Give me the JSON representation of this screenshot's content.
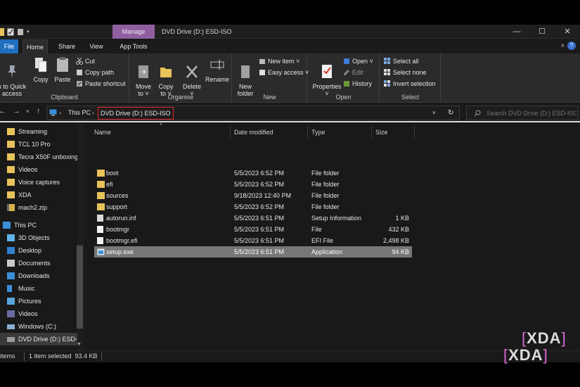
{
  "window": {
    "title": "DVD Drive (D:) ESD-ISO",
    "manage_tab": "Manage",
    "minimize": "—",
    "maximize": "☐",
    "close": "✕"
  },
  "tabs": [
    "File",
    "Home",
    "Share",
    "View",
    "App Tools"
  ],
  "active_tab": "Home",
  "ribbon_collapse": "˄",
  "help": "?",
  "ribbon": {
    "clipboard": {
      "label": "Clipboard",
      "pin": "n to Quick\naccess",
      "copy": "Copy",
      "paste": "Paste",
      "cut": "Cut",
      "copy_path": "Copy path",
      "paste_shortcut": "Paste shortcut"
    },
    "organise": {
      "label": "Organise",
      "move_to": "Move\nto ˅",
      "copy_to": "Copy\nto ˅",
      "delete": "Delete\n˅",
      "rename": "Rename"
    },
    "new": {
      "label": "New",
      "new_folder": "New\nfolder",
      "new_item": "New item ˅",
      "easy_access": "Easy access ˅"
    },
    "open": {
      "label": "Open",
      "properties": "Properties\n˅",
      "open": "Open ˅",
      "edit": "Edit",
      "history": "History"
    },
    "select": {
      "label": "Select",
      "select_all": "Select all",
      "select_none": "Select none",
      "invert": "Invert selection"
    }
  },
  "address": {
    "back": "←",
    "forward": "→",
    "recent": "˅",
    "up": "↑",
    "crumb_root": "This PC",
    "crumb_sep": "›",
    "crumb_current": "DVD Drive (D:) ESD-ISO",
    "dropdown": "˅",
    "refresh": "↻",
    "search_placeholder": "Search DVD Drive (D:) ESD-ISO"
  },
  "nav": [
    {
      "label": "Streaming",
      "icon": "folder-icon"
    },
    {
      "label": "TCL 10 Pro",
      "icon": "folder-icon"
    },
    {
      "label": "Tecra X50F unboxing",
      "icon": "folder-icon"
    },
    {
      "label": "Videos",
      "icon": "folder-icon"
    },
    {
      "label": "Voice captures",
      "icon": "folder-icon"
    },
    {
      "label": "XDA",
      "icon": "folder-icon"
    },
    {
      "label": "mach2.zip",
      "icon": "zip-icon"
    },
    {
      "label": "This PC",
      "icon": "computer-icon"
    },
    {
      "label": "3D Objects",
      "icon": "cube-icon"
    },
    {
      "label": "Desktop",
      "icon": "desktop-icon"
    },
    {
      "label": "Documents",
      "icon": "documents-icon"
    },
    {
      "label": "Downloads",
      "icon": "download-icon"
    },
    {
      "label": "Music",
      "icon": "music-icon"
    },
    {
      "label": "Pictures",
      "icon": "pictures-icon"
    },
    {
      "label": "Videos",
      "icon": "videos-icon"
    },
    {
      "label": "Windows (C:)",
      "icon": "drive-icon"
    },
    {
      "label": "DVD Drive (D:) ESD-I",
      "icon": "dvd-icon"
    }
  ],
  "columns": {
    "name": "Name",
    "date": "Date modified",
    "type": "Type",
    "size": "Size"
  },
  "files": [
    {
      "name": "boot",
      "date": "5/5/2023 6:52 PM",
      "type": "File folder",
      "size": "",
      "icon": "folder-icon"
    },
    {
      "name": "efi",
      "date": "5/5/2023 6:52 PM",
      "type": "File folder",
      "size": "",
      "icon": "folder-icon"
    },
    {
      "name": "sources",
      "date": "9/18/2023 12:40 PM",
      "type": "File folder",
      "size": "",
      "icon": "folder-icon"
    },
    {
      "name": "support",
      "date": "5/5/2023 6:52 PM",
      "type": "File folder",
      "size": "",
      "icon": "folder-icon"
    },
    {
      "name": "autorun.inf",
      "date": "5/5/2023 6:51 PM",
      "type": "Setup Information",
      "size": "1 KB",
      "icon": "settings-file-icon"
    },
    {
      "name": "bootmgr",
      "date": "5/5/2023 6:51 PM",
      "type": "File",
      "size": "432 KB",
      "icon": "file-icon"
    },
    {
      "name": "bootmgr.efi",
      "date": "5/5/2023 6:51 PM",
      "type": "EFI File",
      "size": "2,498 KB",
      "icon": "file-icon"
    },
    {
      "name": "setup.exe",
      "date": "5/5/2023 6:51 PM",
      "type": "Application",
      "size": "94 KB",
      "icon": "setup-app-icon"
    }
  ],
  "selected_file": "setup.exe",
  "status": {
    "items": "items",
    "selected": "1 item selected  93.4 KB"
  },
  "watermark": {
    "left": "[",
    "text": "XDA",
    "right": "]"
  },
  "colors": {
    "manage": "#8f5fa0",
    "file_tab": "#1f6fbf",
    "folder": "#e8c35a",
    "highlight_box": "#e0282d",
    "selected_row": "#777777"
  }
}
